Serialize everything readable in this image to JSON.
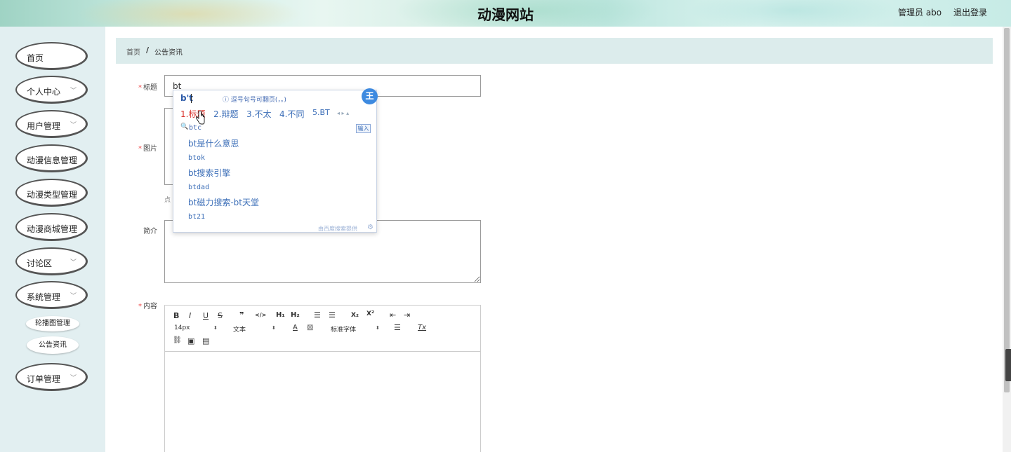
{
  "header": {
    "site_title": "动漫网站",
    "user_info": "管理员 abo",
    "logout_label": "退出登录"
  },
  "sidebar": {
    "items": [
      {
        "label": "首页",
        "has_arrow": false
      },
      {
        "label": "个人中心",
        "has_arrow": true
      },
      {
        "label": "用户管理",
        "has_arrow": true
      },
      {
        "label": "动漫信息管理",
        "has_arrow": false
      },
      {
        "label": "动漫类型管理",
        "has_arrow": false
      },
      {
        "label": "动漫商城管理",
        "has_arrow": false
      },
      {
        "label": "讨论区",
        "has_arrow": true
      },
      {
        "label": "系统管理",
        "has_arrow": true
      },
      {
        "label": "订单管理",
        "has_arrow": true
      }
    ],
    "sub_items": [
      "轮播图管理",
      "公告资讯"
    ]
  },
  "breadcrumb": {
    "home": "首页",
    "separator": "/",
    "current": "公告资讯"
  },
  "form": {
    "title_label": "标题",
    "title_value": "bt",
    "image_label": "图片",
    "upload_tip": "点",
    "intro_label": "简介",
    "content_label": "内容",
    "required_mark": "*"
  },
  "editor": {
    "buttons": {
      "bold": "B",
      "italic": "I",
      "underline": "U",
      "strike": "S",
      "quote": "❞",
      "code": "</>",
      "h1": "H₁",
      "h2": "H₂",
      "ordered_list": "☰",
      "bullet_list": "☰",
      "subscript": "X₂",
      "superscript": "X²",
      "outdent": "⇤",
      "indent": "⇥",
      "font_color": "A",
      "background": "▨",
      "align": "☰",
      "clean": "Tx",
      "link": "⛓",
      "image": "▣",
      "video": "▤"
    },
    "size_value": "14px",
    "header_value": "文本",
    "font_value": "标准字体"
  },
  "ime": {
    "composition": "b't",
    "hint": "ⓘ 逗号句号可翻页(，。)",
    "logo": "王",
    "candidates": [
      "1.标题",
      "2.辩题",
      "3.不太",
      "4.不同",
      "5.BT"
    ],
    "nav": "◂ ▸ ▴",
    "search_icon": "🔍",
    "search_query": "btc",
    "input_button": "输入",
    "suggestions": [
      "bt是什么意思",
      "btok",
      "bt搜索引擎",
      "btdad",
      "bt磁力搜索-bt天堂",
      "bt21"
    ],
    "footer": "由百度搜索提供",
    "gear": "⚙"
  },
  "colors": {
    "sidebar_bg": "#e2eff1",
    "breadcrumb_bg": "#dcecec",
    "required": "#ee4444",
    "ime_link": "#3d6fb8",
    "ime_selected": "#d9312b"
  }
}
